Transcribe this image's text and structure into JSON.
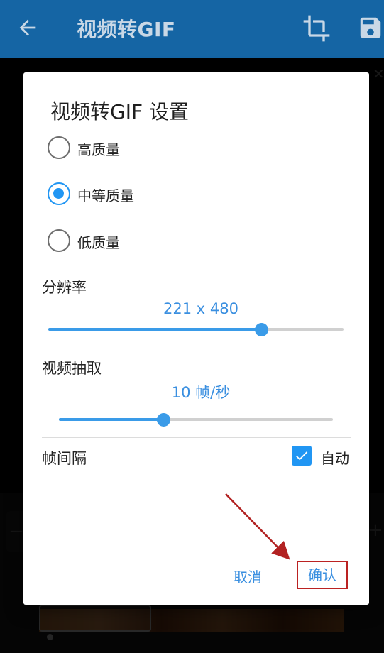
{
  "appbar": {
    "title": "视频转GIF"
  },
  "dialog": {
    "title": "视频转GIF 设置",
    "quality_options": [
      {
        "label": "高质量",
        "selected": false
      },
      {
        "label": "中等质量",
        "selected": true
      },
      {
        "label": "低质量",
        "selected": false
      }
    ],
    "resolution": {
      "label": "分辨率",
      "value": "221 x 480",
      "slider_fraction": 0.72
    },
    "extraction": {
      "label": "视频抽取",
      "value": "10 帧/秒",
      "slider_fraction": 0.38
    },
    "frame_interval": {
      "label": "帧间隔",
      "auto_label": "自动",
      "auto_checked": true
    },
    "buttons": {
      "cancel": "取消",
      "confirm": "确认"
    }
  },
  "colors": {
    "accent": "#2196f3",
    "appbar": "#1565a4",
    "annotation": "#b22222"
  }
}
